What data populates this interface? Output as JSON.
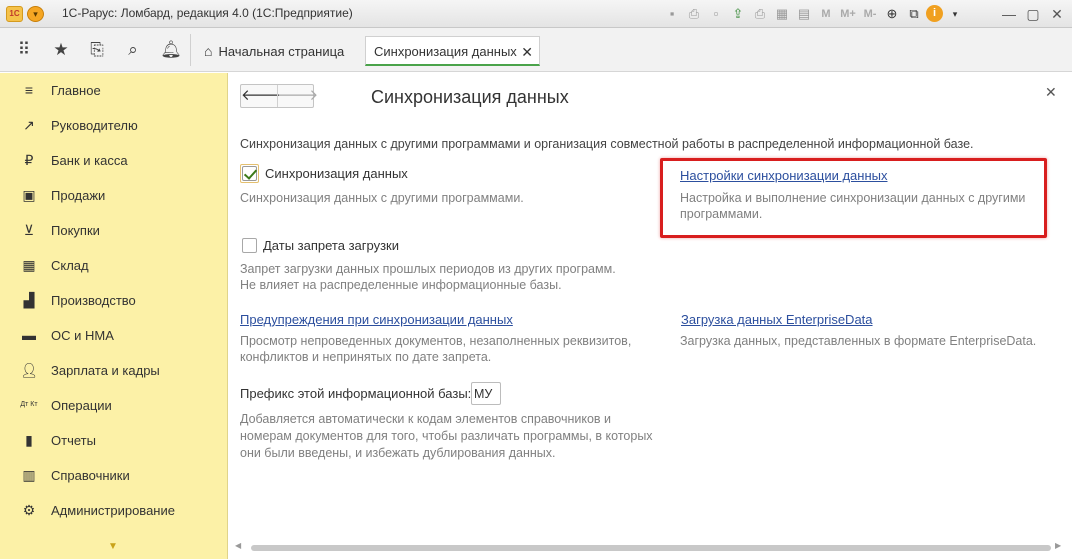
{
  "window": {
    "title": "1С-Рарус: Ломбард, редакция 4.0  (1С:Предприятие)",
    "logo_text": "1С",
    "toolbar_text_icons": [
      "M",
      "M+",
      "M-"
    ]
  },
  "tabs": {
    "home_label": "Начальная страница",
    "active_label": "Синхронизация данных"
  },
  "sidebar": {
    "items": [
      {
        "label": "Главное",
        "icon": "menu-icon"
      },
      {
        "label": "Руководителю",
        "icon": "trend-icon"
      },
      {
        "label": "Банк и касса",
        "icon": "coin-icon"
      },
      {
        "label": "Продажи",
        "icon": "bag-icon"
      },
      {
        "label": "Покупки",
        "icon": "cart-icon"
      },
      {
        "label": "Склад",
        "icon": "warehouse-icon"
      },
      {
        "label": "Производство",
        "icon": "factory-icon"
      },
      {
        "label": "ОС и НМА",
        "icon": "assets-icon"
      },
      {
        "label": "Зарплата и кадры",
        "icon": "person-icon"
      },
      {
        "label": "Операции",
        "icon": "dt-kt-icon"
      },
      {
        "label": "Отчеты",
        "icon": "reports-icon"
      },
      {
        "label": "Справочники",
        "icon": "book-icon"
      },
      {
        "label": "Администрирование",
        "icon": "gear-icon"
      }
    ],
    "dt_kt_text": "Дт Кт"
  },
  "form": {
    "title": "Синхронизация данных",
    "description": "Синхронизация данных с другими программами и организация совместной работы в распределенной информационной базе.",
    "sync_checkbox": {
      "label": "Синхронизация данных",
      "checked": true,
      "hint": "Синхронизация данных с другими программами."
    },
    "sync_settings_link": {
      "label": "Настройки синхронизации данных",
      "hint_line1": "Настройка и выполнение синхронизации данных с другими",
      "hint_line2": "программами."
    },
    "ban_dates_checkbox": {
      "label": "Даты запрета загрузки",
      "checked": false,
      "hint_line1": "Запрет загрузки данных прошлых периодов из других программ.",
      "hint_line2": "Не влияет на распределенные информационные базы."
    },
    "warnings_link": {
      "label": "Предупреждения при синхронизации данных",
      "hint_line1": "Просмотр непроведенных документов, незаполненных реквизитов,",
      "hint_line2": "конфликтов и непринятых по дате запрета."
    },
    "enterprise_link": {
      "label": "Загрузка данных EnterpriseData",
      "hint": "Загрузка данных, представленных в формате EnterpriseData."
    },
    "prefix": {
      "label": "Префикс этой информационной базы:",
      "value": "МУ",
      "hint_line1": "Добавляется автоматически к кодам элементов справочников и",
      "hint_line2": "номерам документов для того, чтобы различать программы, в которых",
      "hint_line3": "они были введены, и избежать дублирования данных."
    }
  },
  "colors": {
    "sidebar_bg": "#fcf1a7",
    "link": "#2c4f9e",
    "highlight": "#d81e1e",
    "active_tab_underline": "#4aa34a"
  }
}
